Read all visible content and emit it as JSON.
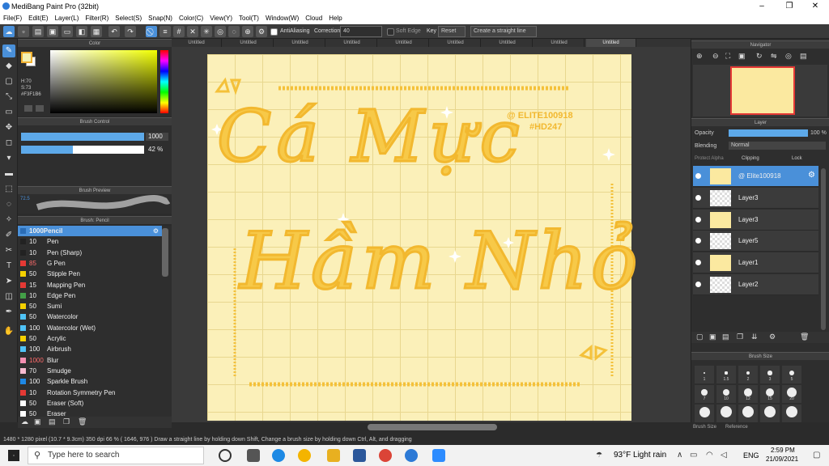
{
  "window": {
    "title": "MediBang Paint Pro (32bit)",
    "controls": [
      "–",
      "❐",
      "✕"
    ]
  },
  "menu": [
    "File(F)",
    "Edit(E)",
    "Layer(L)",
    "Filter(R)",
    "Select(S)",
    "Snap(N)",
    "Color(C)",
    "View(Y)",
    "Tool(T)",
    "Window(W)",
    "Cloud",
    "Help"
  ],
  "toolbar": {
    "antialiasing_label": "AntiAliasing",
    "correction_label": "Correction",
    "correction_value": "40",
    "soft_edge_label": "Soft Edge",
    "key_label": "Key",
    "reset_label": "Reset",
    "straight_line_label": "Create a straight line"
  },
  "tabs": [
    "Untitled",
    "Untitled",
    "Untitled",
    "Untitled",
    "Untitled",
    "Untitled",
    "Untitled",
    "Untitled",
    "Untitled"
  ],
  "color_panel": {
    "title": "Color",
    "h": "H:70",
    "s": "S:73",
    "hex": "#F3F1B6"
  },
  "brush_control": {
    "title": "Brush Control",
    "size_value": "1000",
    "opacity_value": "42 %",
    "opacity_fraction": 0.42
  },
  "brush_preview": {
    "title": "Brush Preview",
    "size_label": "72.5"
  },
  "brush_panel": {
    "title": "Brush: Pencil",
    "items": [
      {
        "size": "",
        "name": "1000Pencil",
        "color": "#2a6cb5",
        "selected": true
      },
      {
        "size": "10",
        "name": "Pen",
        "color": "#222222"
      },
      {
        "size": "10",
        "name": "Pen (Sharp)",
        "color": "#222222"
      },
      {
        "size": "85",
        "name": "G Pen",
        "color": "#e53935"
      },
      {
        "size": "50",
        "name": "Stipple Pen",
        "color": "#f5d000"
      },
      {
        "size": "15",
        "name": "Mapping Pen",
        "color": "#e53935"
      },
      {
        "size": "10",
        "name": "Edge Pen",
        "color": "#43a047"
      },
      {
        "size": "50",
        "name": "Sumi",
        "color": "#f5d000"
      },
      {
        "size": "50",
        "name": "Watercolor",
        "color": "#4fc3f7"
      },
      {
        "size": "100",
        "name": "Watercolor (Wet)",
        "color": "#4fc3f7"
      },
      {
        "size": "50",
        "name": "Acrylic",
        "color": "#f5d000"
      },
      {
        "size": "100",
        "name": "Airbrush",
        "color": "#4fc3f7"
      },
      {
        "size": "1000",
        "name": "Blur",
        "color": "#f48fb1"
      },
      {
        "size": "70",
        "name": "Smudge",
        "color": "#f8bbd0"
      },
      {
        "size": "100",
        "name": "Sparkle Brush",
        "color": "#1e88e5"
      },
      {
        "size": "10",
        "name": "Rotation Symmetry Pen",
        "color": "#e53935"
      },
      {
        "size": "50",
        "name": "Eraser (Soft)",
        "color": "#ffffff"
      },
      {
        "size": "50",
        "name": "Eraser",
        "color": "#ffffff"
      }
    ]
  },
  "canvas": {
    "line1": "Cá Mực",
    "line2": "Hầm Nhỏ",
    "tag1": "@ ELITE100918",
    "tag2": "#HD247"
  },
  "navigator": {
    "title": "Navigator"
  },
  "layer_panel": {
    "title": "Layer",
    "opacity_label": "Opacity",
    "opacity_value": "100 %",
    "blending_label": "Blending",
    "blending_value": "Normal",
    "protect_alpha": "Protect Alpha",
    "clipping": "Clipping",
    "lock": "Lock",
    "layers": [
      {
        "name": "@ Elite100918",
        "selected": true,
        "thumb": "yellow"
      },
      {
        "name": "Layer3",
        "thumb": "clear"
      },
      {
        "name": "Layer3",
        "thumb": "yellow"
      },
      {
        "name": "Layer5",
        "thumb": "clear"
      },
      {
        "name": "Layer1",
        "thumb": "yellow"
      },
      {
        "name": "Layer2",
        "thumb": "clear"
      }
    ]
  },
  "brush_size_panel": {
    "title": "Brush Size",
    "labels": [
      "1",
      "1.5",
      "2",
      "3",
      "5",
      "7",
      "10",
      "12",
      "15",
      "20"
    ],
    "tab1": "Brush Size",
    "tab2": "Reference"
  },
  "status": "1480 * 1280 pixel  (10.7 * 9.3cm)  350 dpi  66 %  ( 1646, 976 )  Draw a straight line by holding down Shift, Change a brush size by holding down Ctrl, Alt, and dragging",
  "taskbar": {
    "search_placeholder": "Type here to search",
    "weather": "93°F  Light rain",
    "lang": "ENG",
    "time": "2:59 PM",
    "date": "21/09/2021"
  },
  "colors": {
    "accent": "#4a90d9",
    "canvas_bg": "#fbf0b9",
    "lettering": "#f7c948"
  }
}
